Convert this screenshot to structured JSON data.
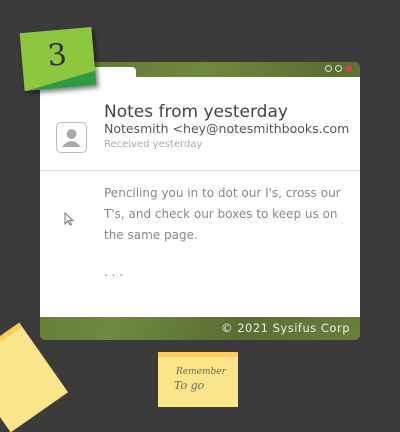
{
  "badge": {
    "number": "3"
  },
  "window": {
    "controls": [
      "minimize",
      "maximize",
      "close"
    ],
    "title": "Notes from yesterday"
  },
  "email": {
    "sender": "Notesmith <hey@notesmithbooks.com",
    "received": "Received yesterday",
    "body": "Penciling you in to dot our I's, cross our T's, and check our boxes to keep us on the same page.",
    "ellipsis": ". . ."
  },
  "footer": {
    "copyright": "© 2021 Sysifus Corp"
  },
  "notes": {
    "remember_line1": "Remember",
    "remember_line2": "To go"
  },
  "colors": {
    "green": "#8dc63f",
    "dark_green": "#2e9a45",
    "background": "#3b3b3b",
    "sticky_yellow": "#fbe58a"
  }
}
